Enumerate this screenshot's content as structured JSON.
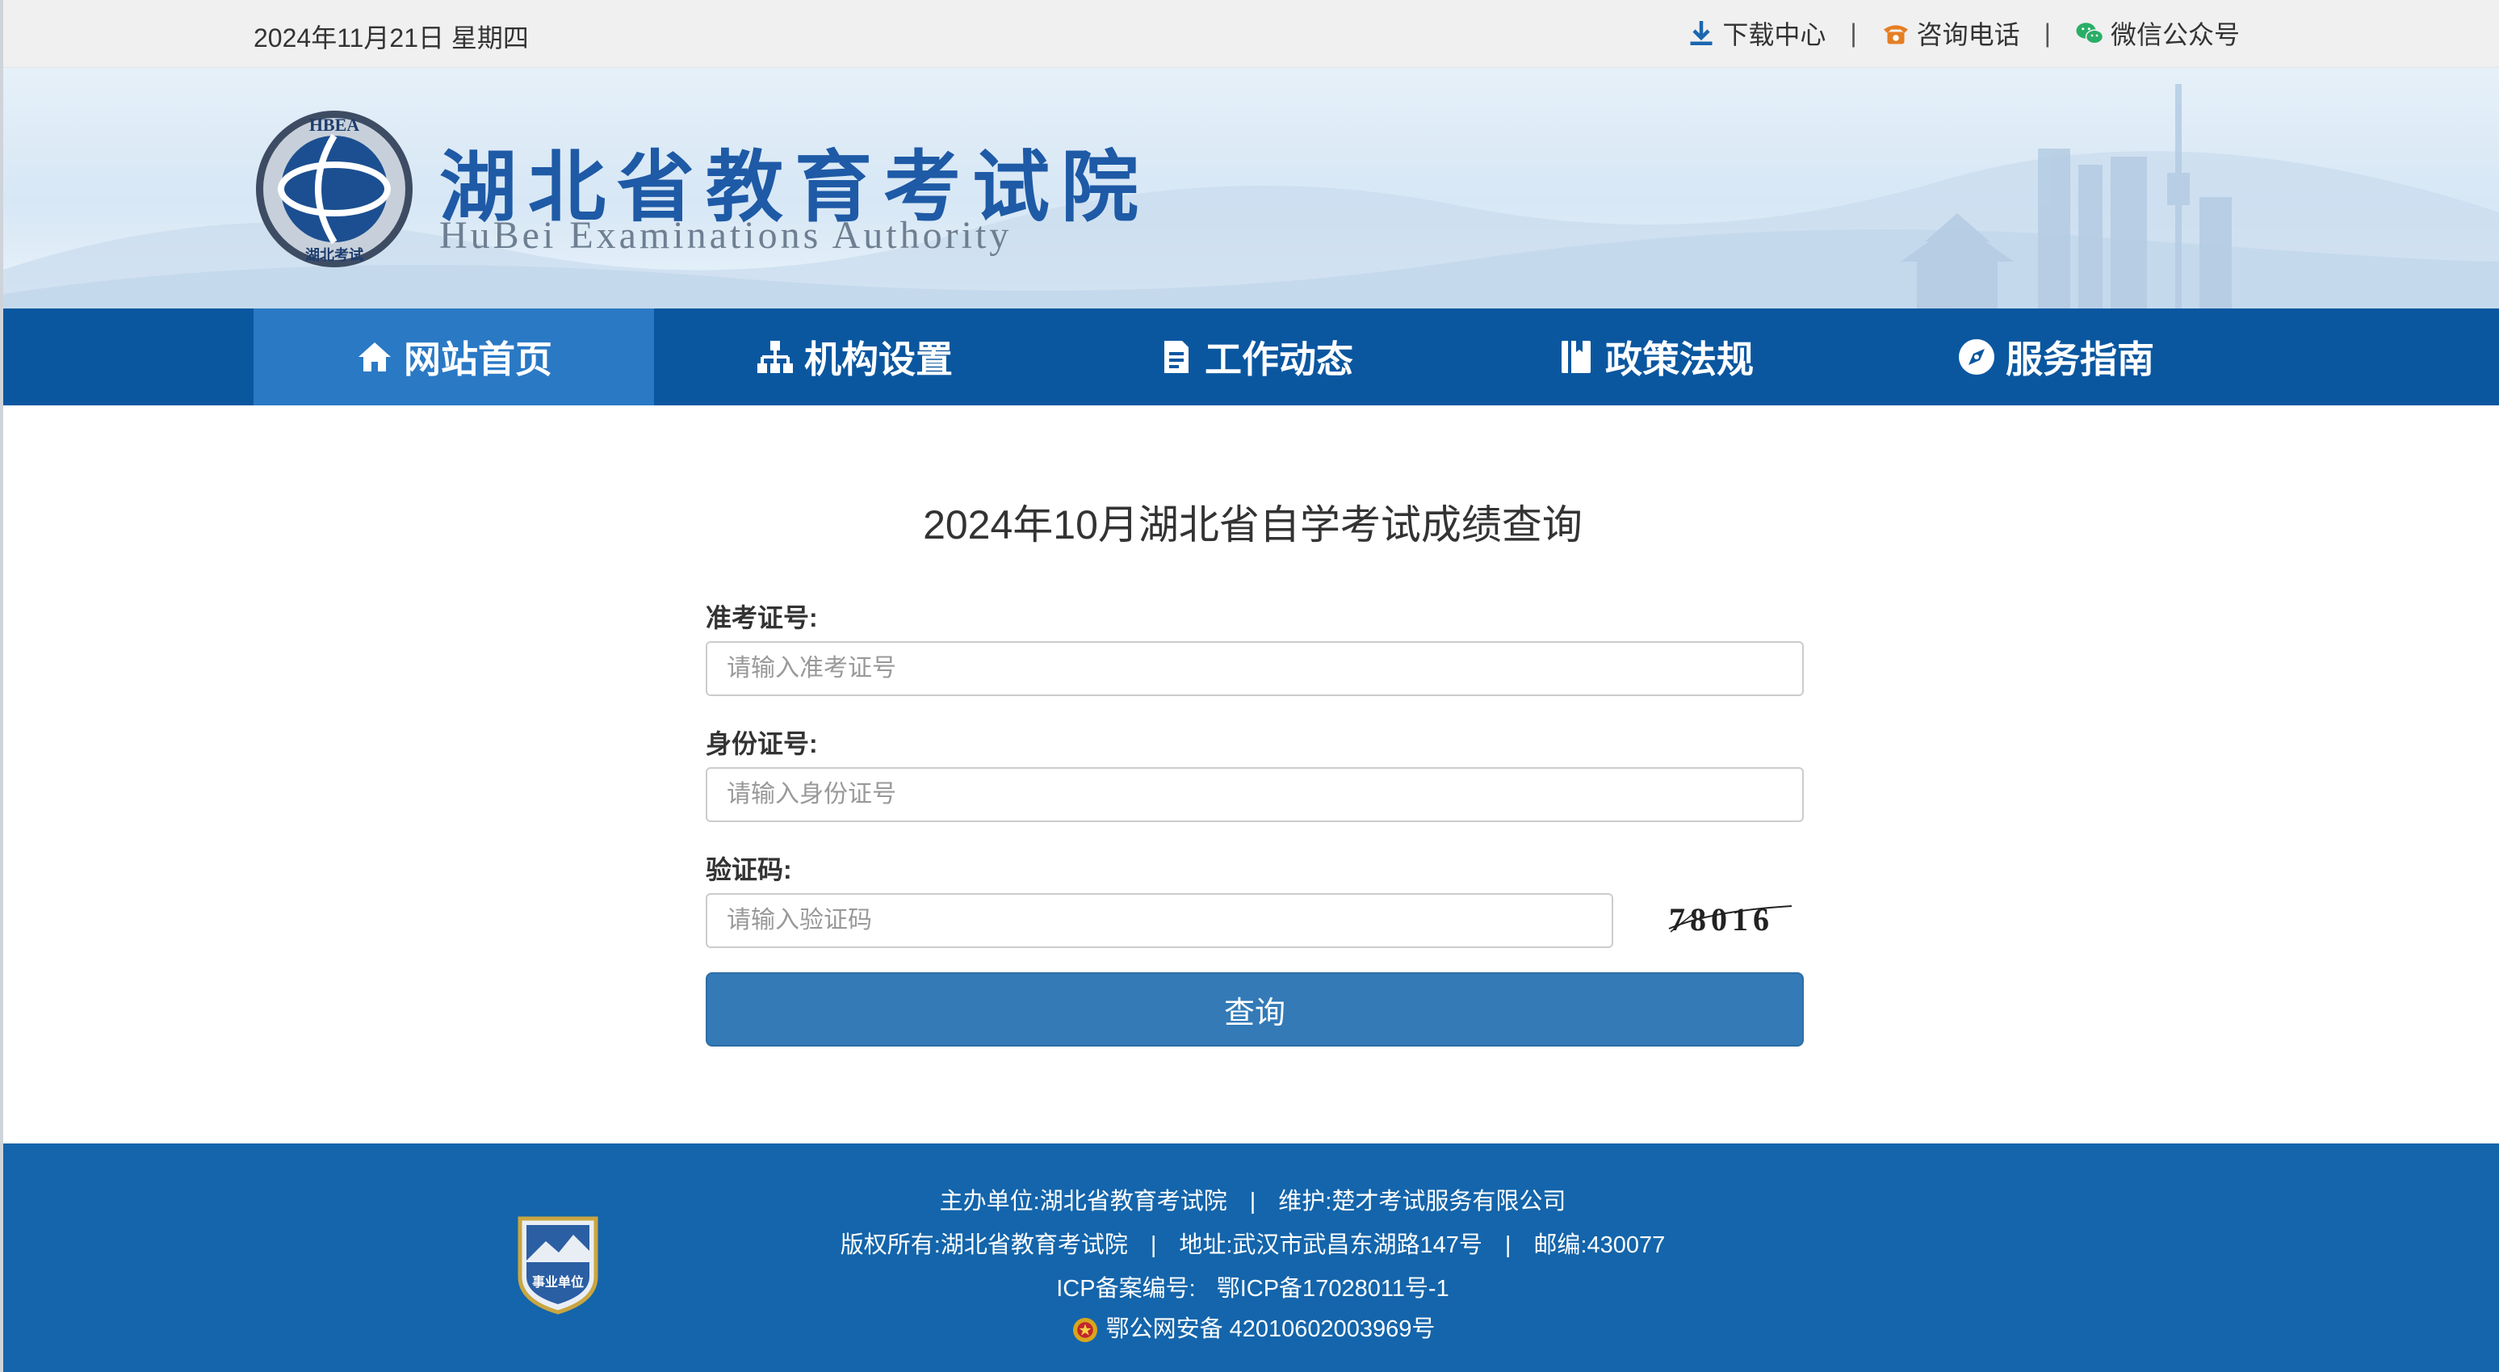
{
  "topbar": {
    "date": "2024年11月21日 星期四",
    "links": [
      {
        "label": "下载中心",
        "icon": "download-icon"
      },
      {
        "label": "咨询电话",
        "icon": "phone-icon"
      },
      {
        "label": "微信公众号",
        "icon": "wechat-icon"
      }
    ],
    "separator": "|"
  },
  "banner": {
    "emblem_text": "HBEA",
    "emblem_bottom_text": "湖北考试",
    "title": "湖北省教育考试院",
    "subtitle": "HuBei Examinations Authority"
  },
  "nav": {
    "items": [
      {
        "label": "网站首页",
        "icon": "home-icon",
        "active": true
      },
      {
        "label": "机构设置",
        "icon": "org-chart-icon",
        "active": false
      },
      {
        "label": "工作动态",
        "icon": "document-icon",
        "active": false
      },
      {
        "label": "政策法规",
        "icon": "book-icon",
        "active": false
      },
      {
        "label": "服务指南",
        "icon": "compass-icon",
        "active": false
      }
    ]
  },
  "form": {
    "title": "2024年10月湖北省自学考试成绩查询",
    "fields": [
      {
        "label": "准考证号:",
        "placeholder": "请输入准考证号",
        "value": ""
      },
      {
        "label": "身份证号:",
        "placeholder": "请输入身份证号",
        "value": ""
      },
      {
        "label": "验证码:",
        "placeholder": "请输入验证码",
        "value": ""
      }
    ],
    "captcha_text": "78016",
    "submit_label": "查询"
  },
  "footer": {
    "host": "主办单位:湖北省教育考试院",
    "maintainer": "维护:楚才考试服务有限公司",
    "copyright": "版权所有:湖北省教育考试院",
    "address": "地址:武汉市武昌东湖路147号",
    "postcode": "邮编:430077",
    "icp_label": "ICP备案编号:",
    "icp_number": "鄂ICP备17028011号-1",
    "police_record": "鄂公网安备 42010602003969号",
    "badge_text": "事业单位",
    "separator": "|"
  },
  "colors": {
    "nav_bg": "#0a57a0",
    "nav_active": "#2a79c5",
    "button": "#337ab7",
    "footer_bg": "#1465ab",
    "title_blue": "#1e5aa6"
  }
}
